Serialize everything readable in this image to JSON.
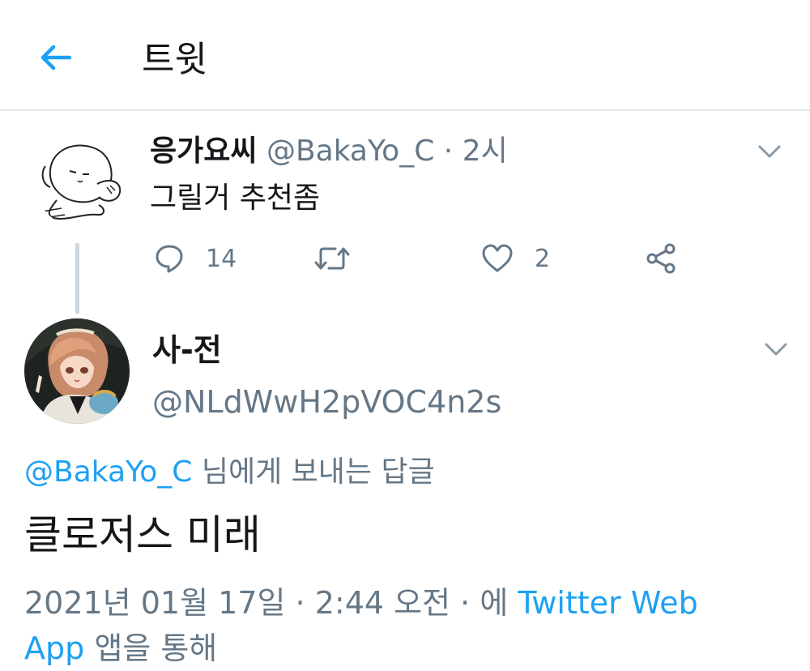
{
  "header": {
    "title": "트윗"
  },
  "tweet1": {
    "name": "응가요씨",
    "handle": "@BakaYo_C",
    "separator": "·",
    "time": "2시",
    "text": "그릴거 추천좀",
    "actions": {
      "reply_count": "14",
      "retweet_count": "",
      "like_count": "2"
    }
  },
  "tweet2": {
    "name": "사-전",
    "handle": "@NLdWwH2pVOC4n2s",
    "reply_to": {
      "handle": "@BakaYo_C",
      "suffix": "님에게 보내는 답글"
    },
    "text": "클로저스 미래",
    "date": "2021년 01월 17일",
    "time": "2:44 오전",
    "separator": "·",
    "via_prefix": "에",
    "source_part1": "Twitter Web",
    "source_part2": "App",
    "via_suffix": "앱을 통해"
  },
  "colors": {
    "accent": "#1da1f2",
    "secondary_text": "#657786",
    "primary_text": "#14171a",
    "divider": "#e1e8ed"
  },
  "icons": [
    "back-arrow-icon",
    "chevron-down-icon",
    "reply-icon",
    "retweet-icon",
    "like-icon",
    "share-icon"
  ]
}
